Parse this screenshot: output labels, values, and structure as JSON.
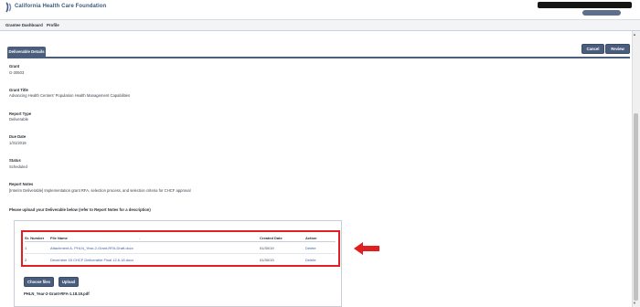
{
  "header": {
    "org_name": "California Health Care Foundation"
  },
  "nav": {
    "items": [
      {
        "label": "Grantee Dashboard"
      },
      {
        "label": "Profile"
      }
    ]
  },
  "tabs": {
    "active": "Deliverable Details"
  },
  "actions": {
    "cancel": "Cancel",
    "review": "Review"
  },
  "fields": [
    {
      "label": "Grant",
      "value": "G-30503"
    },
    {
      "label": "Grant Title",
      "value": "Advancing Health Centers' Population Health Management Capabilities"
    },
    {
      "label": "Report Type",
      "value": "Deliverable"
    },
    {
      "label": "Due Date",
      "value": "1/31/2019"
    },
    {
      "label": "Status",
      "value": "Scheduled"
    },
    {
      "label": "Report Notes",
      "value": "[Interim Deliverable] Implementation grant RFA, selection process, and selection criteria for CHCF approval"
    }
  ],
  "upload": {
    "heading": "Please upload your Deliverable below (refer to Report Notes for a description)",
    "columns": [
      "Sr. Number",
      "File Name",
      "Created Date",
      "Action"
    ],
    "rows": [
      {
        "number": "1",
        "file_name": "Attachment A- PHLN_Year-2-Grant-RFA-Draft.docx",
        "created": "01/30/19",
        "action": "Delete"
      },
      {
        "number": "2",
        "file_name": "December 15 CHCF Deliverable Final 12.6.18.docx",
        "created": "01/30/19",
        "action": "Delete"
      }
    ],
    "choose_files": "Choose files",
    "upload_button": "Upload",
    "selected_file": "PHLN_Year-2-Grant-RFA-1.18.19.pdf"
  },
  "colors": {
    "brand": "#4b5d7c",
    "highlight": "#e02020",
    "link": "#3b62a8"
  }
}
